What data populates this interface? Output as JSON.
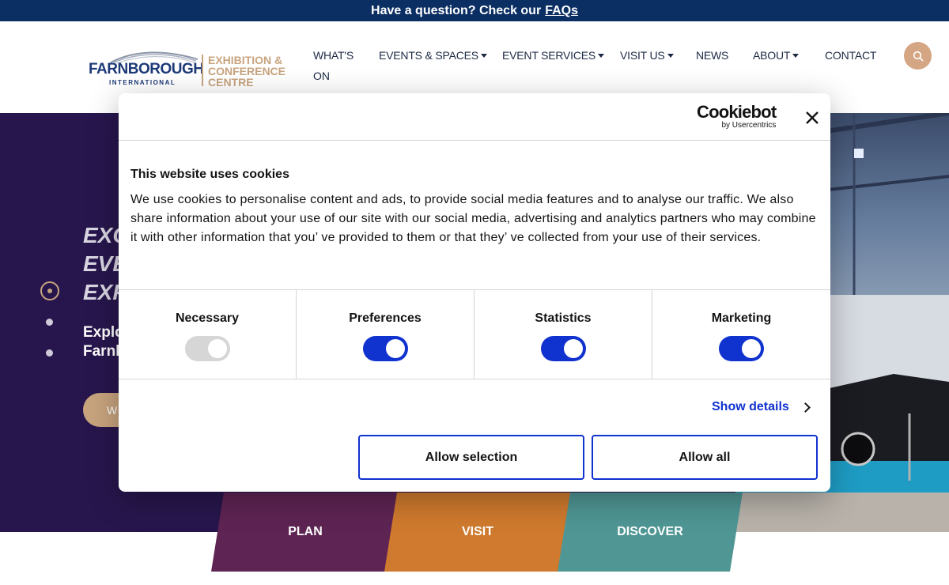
{
  "banner": {
    "text": "Have a question? Check our",
    "link": "FAQs"
  },
  "logo": {
    "brand": "FARNBOROUGH",
    "sub": "INTERNATIONAL",
    "ecc_line1": "EXHIBITION &",
    "ecc_line2": "CONFERENCE",
    "ecc_line3": "CENTRE"
  },
  "nav": {
    "whats_on_line1": "WHAT'S",
    "whats_on_line2": "ON",
    "events_spaces": "EVENTS & SPACES",
    "event_services": "EVENT SERVICES",
    "visit_us": "VISIT US",
    "news": "NEWS",
    "about": "ABOUT",
    "contact": "CONTACT"
  },
  "hero": {
    "heading_line1": "EXC",
    "heading_line2": "EVE",
    "heading_line3": "EXP",
    "sub_line1": "Explo",
    "sub_line2": "Farnb",
    "button": "W"
  },
  "tiles": {
    "plan": "PLAN",
    "visit": "VISIT",
    "discover": "DISCOVER"
  },
  "cookie": {
    "logo_main": "Cookiebot",
    "logo_sub": "by Usercentrics",
    "title": "This website uses cookies",
    "body": "We use cookies to personalise content and ads, to provide social media features and to analyse our traffic. We also share information about your use of our site with our social media, advertising and analytics partners who may combine it with other information that you’ ve provided to them or that they’ ve collected from your use of their services.",
    "categories": [
      {
        "label": "Necessary",
        "enabled": true,
        "locked": true
      },
      {
        "label": "Preferences",
        "enabled": true,
        "locked": false
      },
      {
        "label": "Statistics",
        "enabled": true,
        "locked": false
      },
      {
        "label": "Marketing",
        "enabled": true,
        "locked": false
      }
    ],
    "show_details": "Show details",
    "allow_selection": "Allow selection",
    "allow_all": "Allow all"
  },
  "colors": {
    "navy": "#0b2f63",
    "gold": "#c8a47e",
    "cookie_blue": "#1032cf",
    "hero_purple": "#27164d"
  }
}
